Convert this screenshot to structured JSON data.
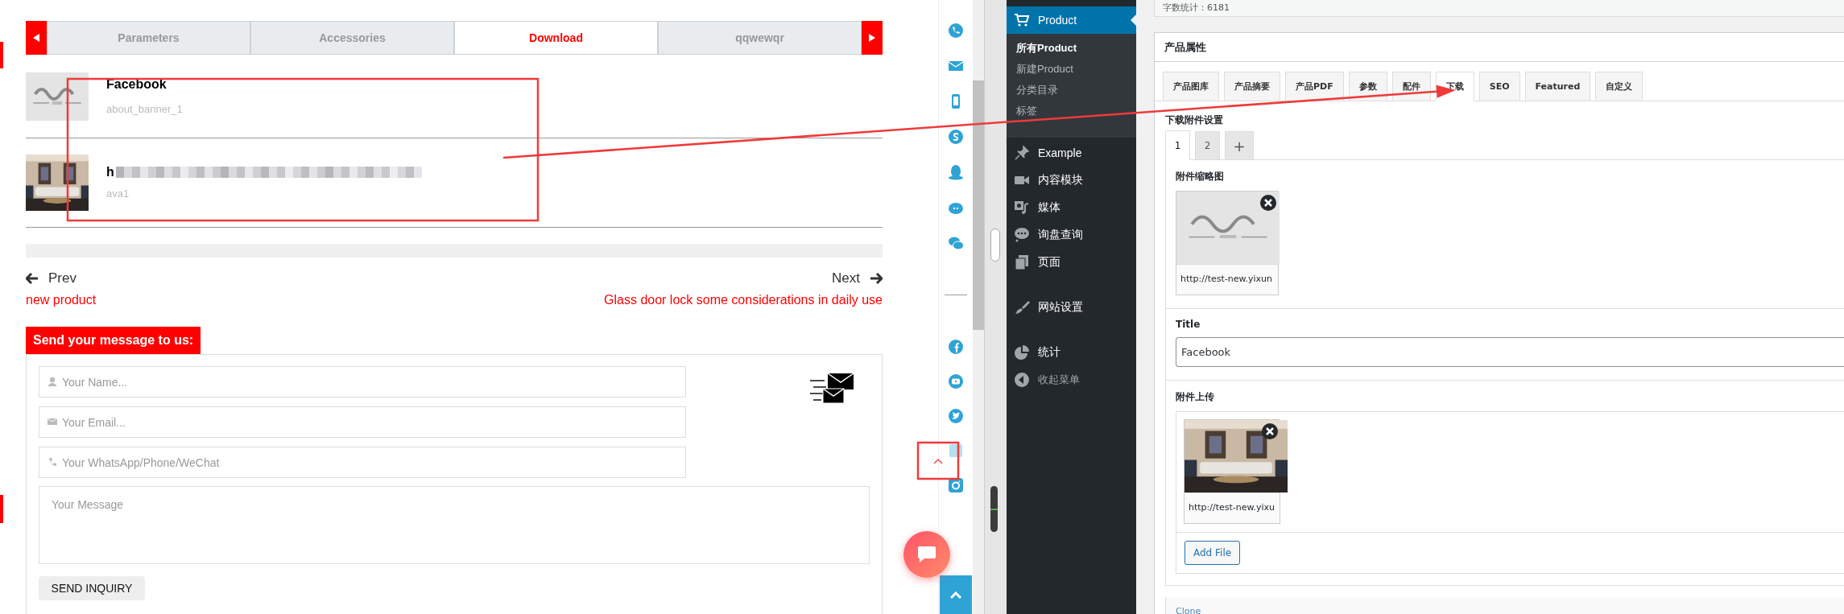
{
  "site": {
    "tabs": [
      {
        "label": "Parameters",
        "selected": false
      },
      {
        "label": "Accessories",
        "selected": false
      },
      {
        "label": "Download",
        "selected": true
      },
      {
        "label": "qqwewqr",
        "selected": false
      }
    ],
    "downloads": [
      {
        "title": "Facebook",
        "file": "about_banner_1",
        "redacted": false
      },
      {
        "title": "h",
        "file": "ava1",
        "redacted": true
      }
    ],
    "prev": {
      "label": "Prev",
      "link": "new product"
    },
    "next": {
      "label": "Next",
      "link": "Glass door lock some considerations in daily use"
    },
    "form": {
      "heading": "Send your message to us:",
      "fields": [
        {
          "kind": "person",
          "placeholder": "Your Name..."
        },
        {
          "kind": "mail",
          "placeholder": "Your Email..."
        },
        {
          "kind": "phone",
          "placeholder": "Your WhatsApp/Phone/WeChat"
        }
      ],
      "message_placeholder": "Your Message",
      "submit": "SEND INQUIRY"
    }
  },
  "side_icons": [
    {
      "kind": "phone-bubble"
    },
    {
      "kind": "envelope"
    },
    {
      "kind": "mobile"
    },
    {
      "kind": "s-circle"
    },
    {
      "kind": "penguin"
    },
    {
      "kind": "eye-blob"
    },
    {
      "kind": "chat-bubbles"
    }
  ],
  "social_icons": [
    {
      "kind": "f-circle"
    },
    {
      "kind": "play-circle"
    },
    {
      "kind": "bird-circle"
    },
    {
      "kind": "square-tile"
    },
    {
      "kind": "camera-square"
    }
  ],
  "admin_menu": [
    {
      "kind": "item",
      "label": "Product",
      "selected": true,
      "children": [
        {
          "label": "所有Product",
          "selected": true
        },
        {
          "label": "新建Product",
          "selected": false
        },
        {
          "label": "分类目录",
          "selected": false
        },
        {
          "label": "标签",
          "selected": false
        }
      ]
    },
    {
      "kind": "item",
      "label": "Example",
      "selected": false
    },
    {
      "kind": "item",
      "label": "内容模块",
      "selected": false
    },
    {
      "kind": "item",
      "label": "媒体",
      "selected": false
    },
    {
      "kind": "item",
      "label": "询盘查询",
      "selected": false
    },
    {
      "kind": "item",
      "label": "页面",
      "selected": false
    },
    {
      "kind": "separator"
    },
    {
      "kind": "item",
      "label": "网站设置",
      "selected": false
    },
    {
      "kind": "separator"
    },
    {
      "kind": "item",
      "label": "统计",
      "selected": false
    },
    {
      "kind": "collapse",
      "label": "收起菜单",
      "selected": false
    }
  ],
  "word_count": "字数统计：6181",
  "panel": {
    "title": "产品属性",
    "tabs": [
      {
        "label": "产品图库",
        "selected": false
      },
      {
        "label": "产品摘要",
        "selected": false
      },
      {
        "label": "产品PDF",
        "selected": false
      },
      {
        "label": "参数",
        "selected": false
      },
      {
        "label": "配件",
        "selected": false
      },
      {
        "label": "下载",
        "selected": true
      },
      {
        "label": "SEO",
        "selected": false
      },
      {
        "label": "Featured",
        "selected": false
      },
      {
        "label": "自定义",
        "selected": false
      }
    ],
    "section_title": "下载附件设置",
    "sub_tabs": [
      {
        "label": "1",
        "selected": true
      },
      {
        "label": "2",
        "selected": false
      },
      {
        "label": "+",
        "selected": false
      }
    ],
    "thumb_label": "附件缩略图",
    "thumb_url": "http://test-new.yixun",
    "title_label": "Title",
    "title_value": "Facebook",
    "upload_label": "附件上传",
    "upload_url": "http://test-new.yixu",
    "add_button": "Add File",
    "clone": "Clone"
  },
  "annotations": [
    {
      "kind": "box"
    },
    {
      "kind": "arrow"
    },
    {
      "kind": "box"
    }
  ]
}
